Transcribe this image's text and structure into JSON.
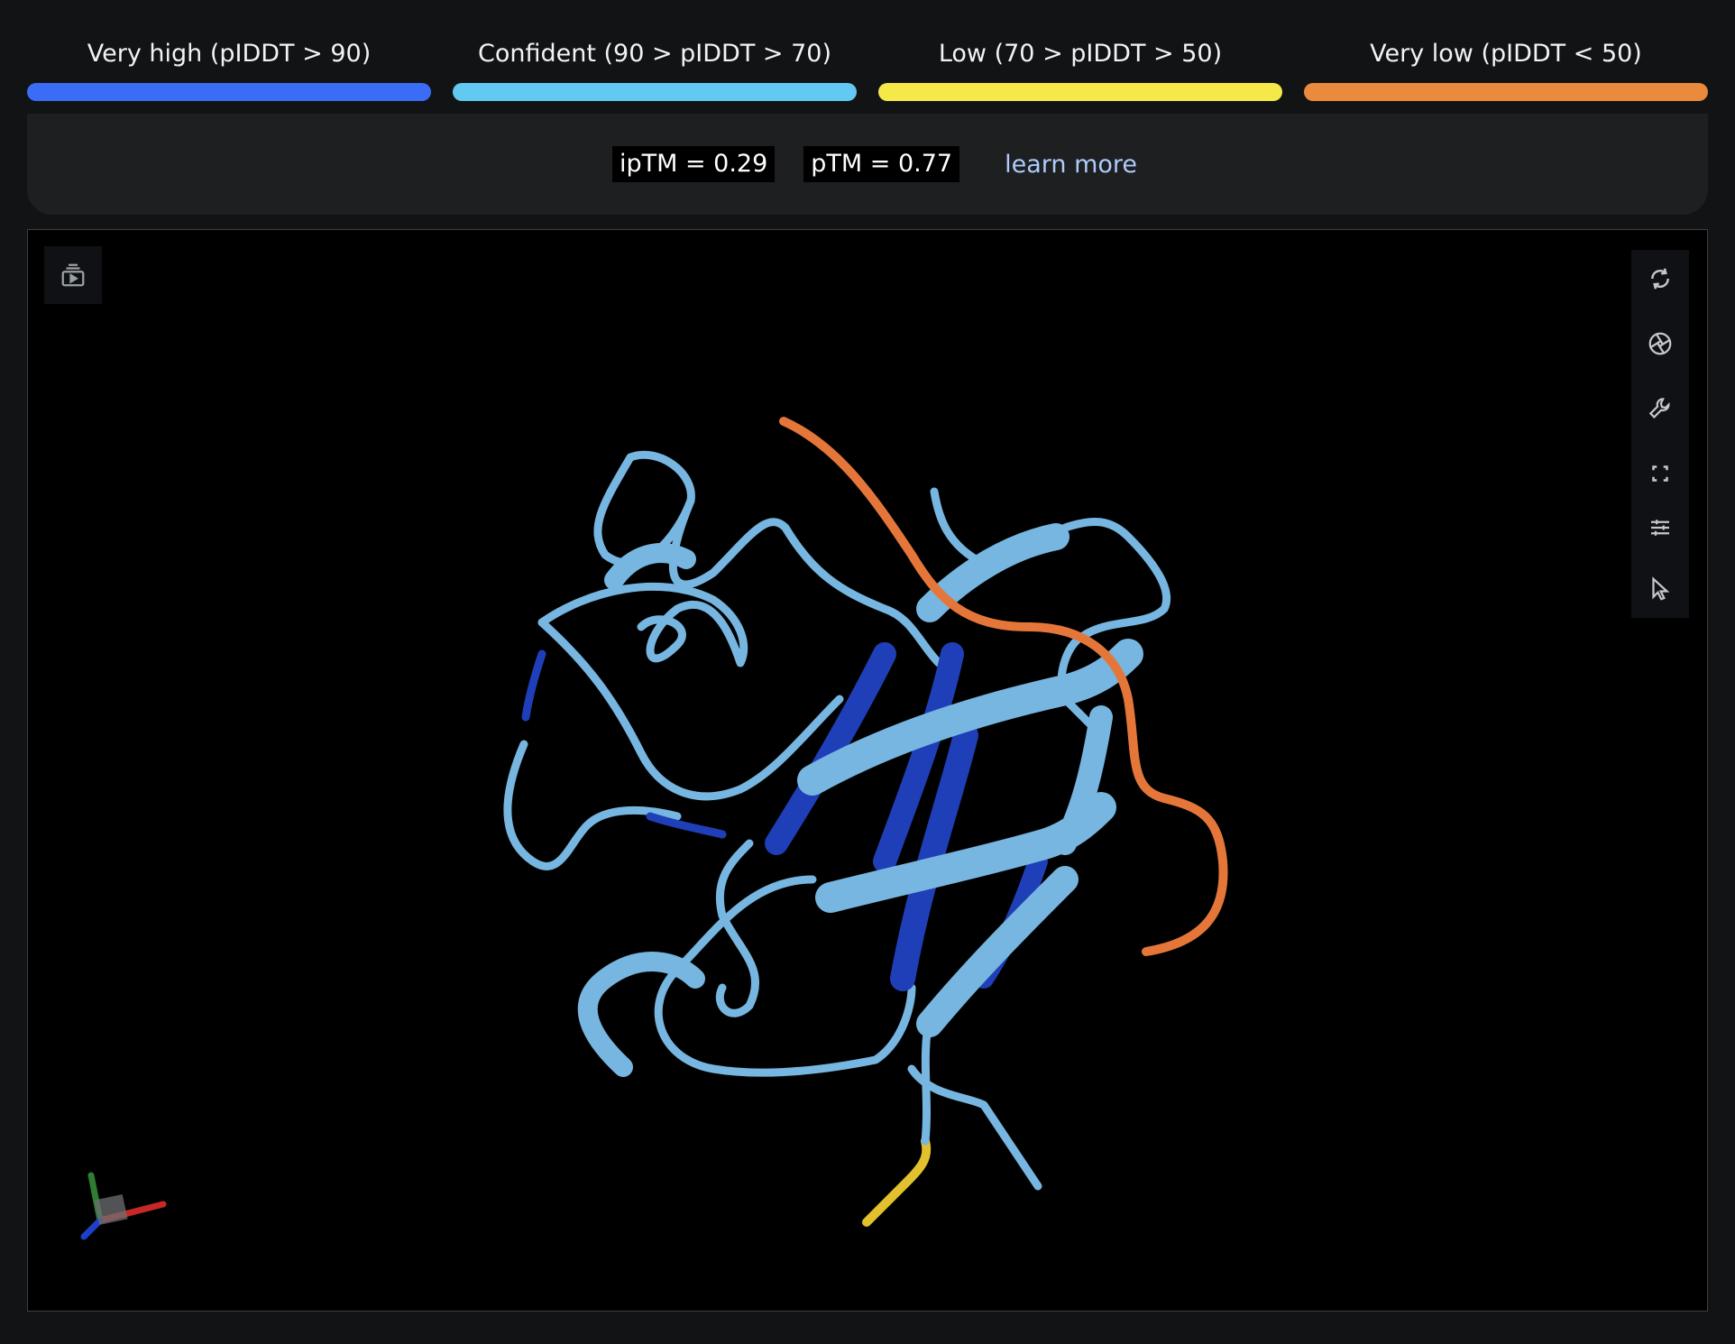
{
  "legend": [
    {
      "label": "Very high (pIDDT > 90)",
      "color": "#3b6cf6"
    },
    {
      "label": "Confident (90 > pIDDT > 70)",
      "color": "#62c9f2"
    },
    {
      "label": "Low (70 > pIDDT > 50)",
      "color": "#f5e94a"
    },
    {
      "label": "Very low (pIDDT < 50)",
      "color": "#ea8a3c"
    }
  ],
  "scores": {
    "iptm": "ipTM = 0.29",
    "ptm": "pTM = 0.77",
    "learn_more": "learn more"
  },
  "viewer": {
    "toolbar_left": [
      {
        "icon": "animation-icon"
      }
    ],
    "toolbar_right": [
      {
        "icon": "reset-view-icon"
      },
      {
        "icon": "screenshot-icon"
      },
      {
        "icon": "settings-wrench-icon"
      },
      {
        "icon": "fullscreen-icon"
      },
      {
        "icon": "controls-sliders-icon"
      },
      {
        "icon": "select-cursor-icon"
      }
    ],
    "structure_colors": {
      "very_high": "#1f3fb8",
      "confident": "#76b6e0",
      "low": "#e2c12f",
      "very_low": "#e5763a"
    }
  }
}
